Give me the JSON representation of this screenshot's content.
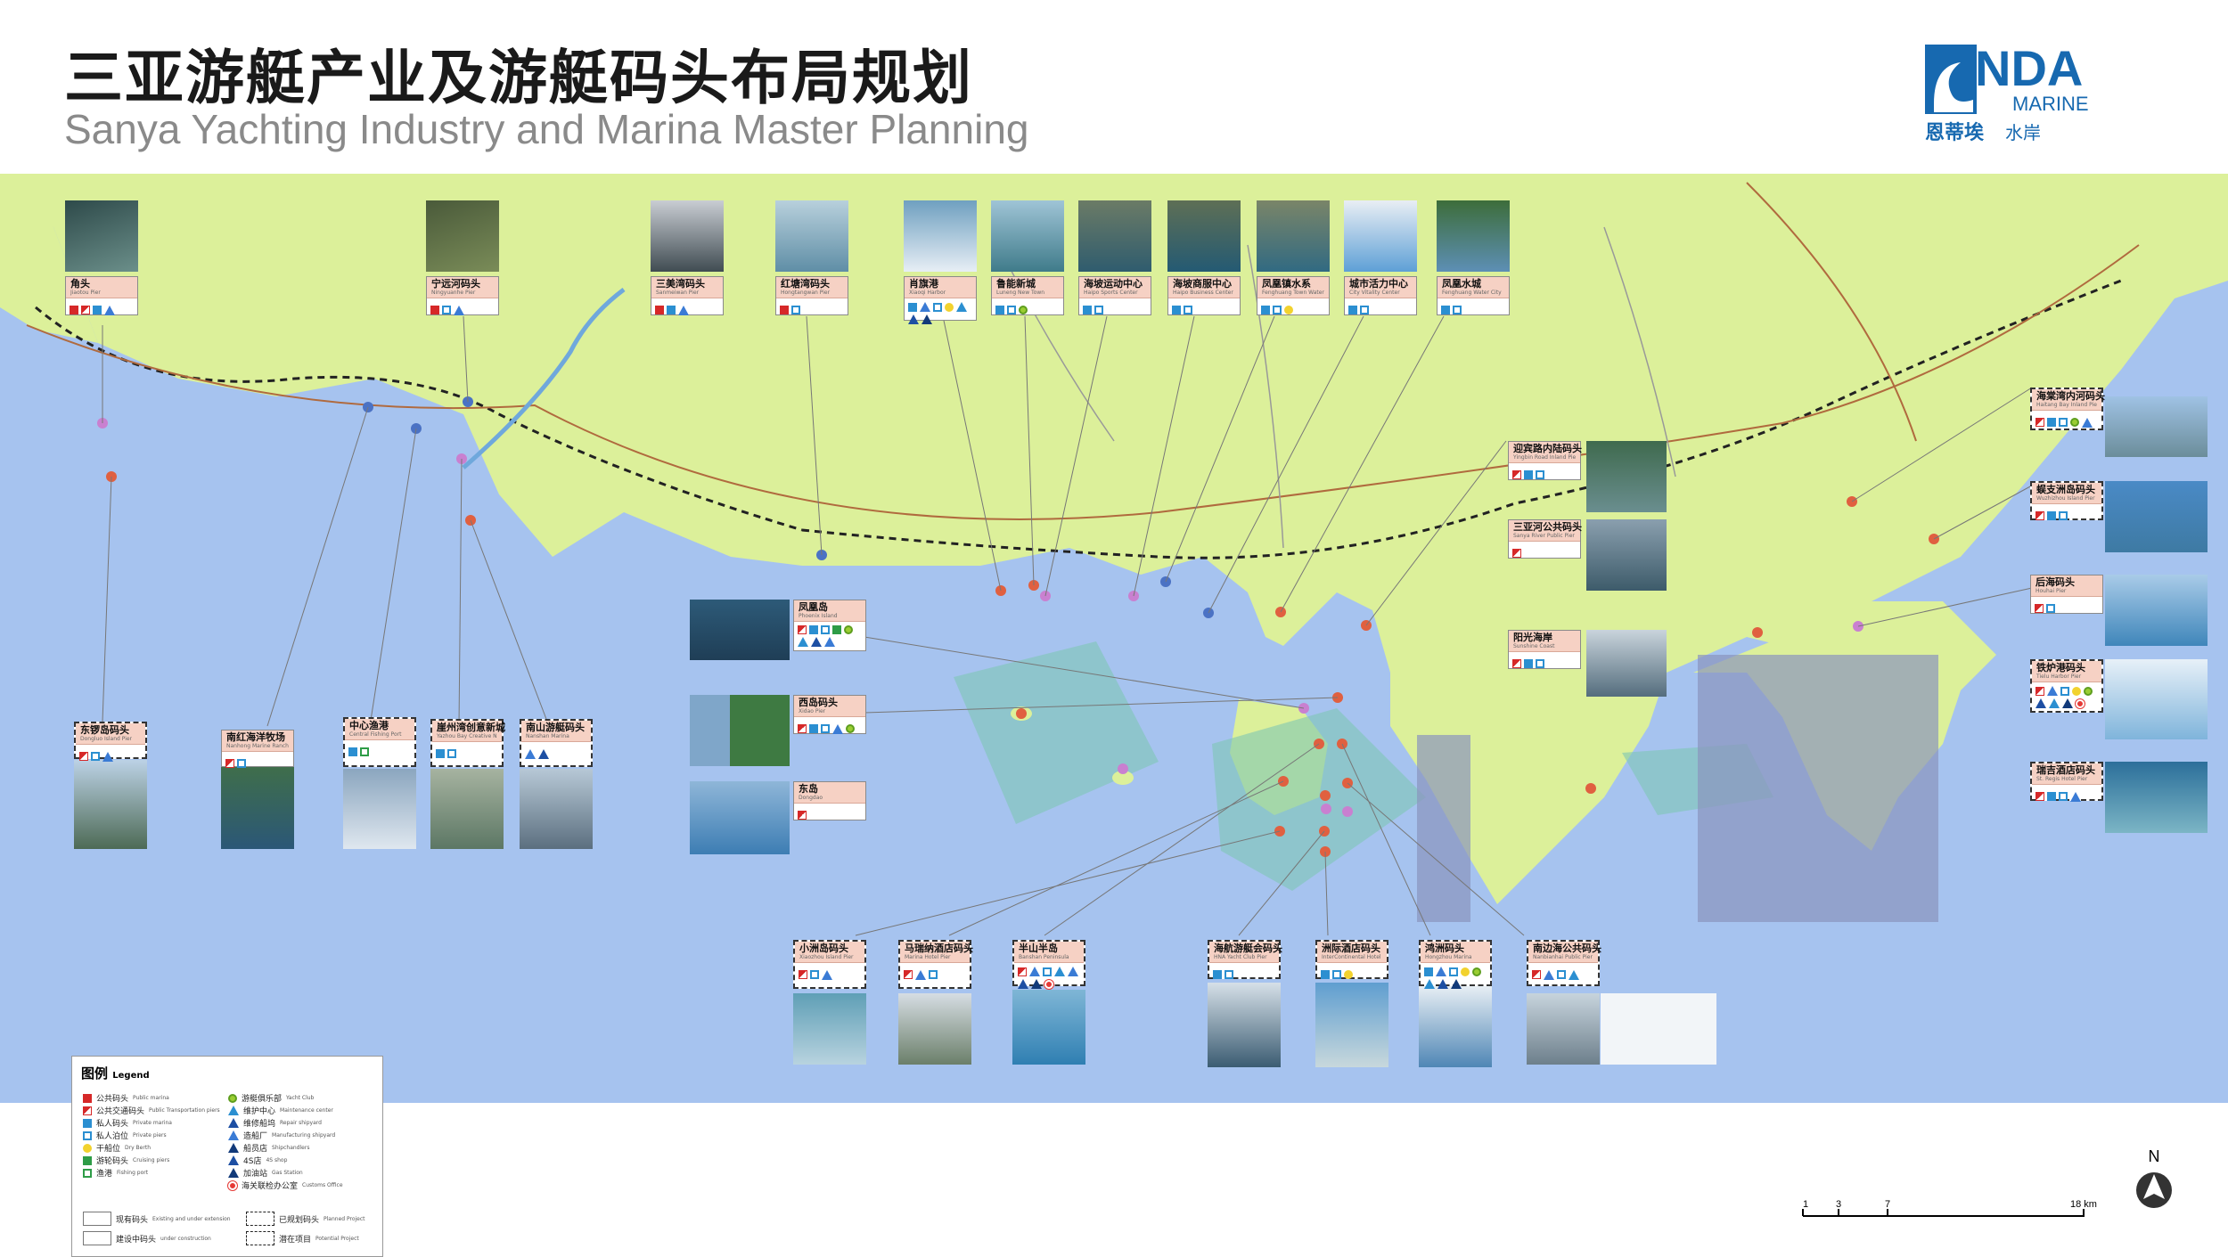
{
  "title_cn": "三亚游艇产业及游艇码头布局规划",
  "title_en": "Sanya Yachting Industry and Marina Master Planning",
  "logo": {
    "letters": "NDA",
    "line2": "MARINE",
    "cn": "恩蒂埃",
    "cn2": "水岸"
  },
  "colors": {
    "sea": "#a6c3ef",
    "land": "#dcf09a",
    "public": "#d62828",
    "private": "#2b8fd1",
    "header_pink": "#f6d1c4"
  },
  "callouts": [
    {
      "id": "jiaotou",
      "cn": "角头",
      "en": "Jiaotou Pier",
      "icons": [
        "pub",
        "pt",
        "pm",
        "ms"
      ]
    },
    {
      "id": "ningyuanhe",
      "cn": "宁远河码头",
      "en": "Ningyuanhe Pier",
      "icons": [
        "pub",
        "pb",
        "ms"
      ]
    },
    {
      "id": "sanmeiwan",
      "cn": "三美湾码头",
      "en": "Sanmeiwan Pier",
      "icons": [
        "pub",
        "pm",
        "ms"
      ]
    },
    {
      "id": "hongtangwan",
      "cn": "红塘湾码头",
      "en": "Hongtangwan Pier",
      "icons": [
        "pub",
        "pb"
      ]
    },
    {
      "id": "xiaogang",
      "cn": "肖旗港",
      "en": "Xiaoqi Harbor",
      "icons": [
        "pm",
        "ms",
        "pb",
        "db",
        "mc",
        "rs",
        "sc"
      ]
    },
    {
      "id": "luneng",
      "cn": "鲁能新城",
      "en": "Luneng New Town",
      "icons": [
        "pm",
        "pb",
        "yc"
      ]
    },
    {
      "id": "haipo",
      "cn": "海坡运动中心",
      "en": "Haipo Sports Center",
      "icons": [
        "pm",
        "pb"
      ]
    },
    {
      "id": "haipodp",
      "cn": "海坡商服中心",
      "en": "Haipo Business Center",
      "icons": [
        "pm",
        "pb"
      ]
    },
    {
      "id": "fenghuangzhen",
      "cn": "凤凰镇水系",
      "en": "Fenghuang Town Water System",
      "icons": [
        "pm",
        "pb",
        "db"
      ]
    },
    {
      "id": "chengshi",
      "cn": "城市活力中心",
      "en": "City Vitality Center",
      "icons": [
        "pm",
        "pb"
      ]
    },
    {
      "id": "fenghuangshui",
      "cn": "凤凰水城",
      "en": "Fenghuang Water City",
      "icons": [
        "pm",
        "pb"
      ]
    },
    {
      "id": "yingbin",
      "cn": "迎宾路内陆码头",
      "en": "Yingbin Road Inland Pier",
      "icons": [
        "pt",
        "pm",
        "pb"
      ]
    },
    {
      "id": "sanyahe",
      "cn": "三亚河公共码头",
      "en": "Sanya River Public Pier",
      "icons": [
        "pt"
      ]
    },
    {
      "id": "yangguang",
      "cn": "阳光海岸",
      "en": "Sunshine Coast",
      "icons": [
        "pt",
        "pm",
        "pb"
      ]
    },
    {
      "id": "haitang",
      "cn": "海棠湾内河码头",
      "en": "Haitang Bay Inland Pier",
      "icons": [
        "pt",
        "pm",
        "pb",
        "yc",
        "ms"
      ]
    },
    {
      "id": "wuzhizhou",
      "cn": "蜈支洲岛码头",
      "en": "Wuzhizhou Island Pier",
      "icons": [
        "pt",
        "pm",
        "pb"
      ]
    },
    {
      "id": "houhai",
      "cn": "后海码头",
      "en": "Houhai Pier",
      "icons": [
        "pt",
        "pb"
      ]
    },
    {
      "id": "tielu",
      "cn": "铁炉港码头",
      "en": "Tielu Harbor Pier",
      "icons": [
        "pt",
        "ms",
        "pb",
        "db",
        "yc",
        "rs",
        "mc",
        "sc",
        "co"
      ]
    },
    {
      "id": "rizhao",
      "cn": "瑞吉酒店码头",
      "en": "St. Regis Hotel Pier",
      "icons": [
        "pt",
        "pm",
        "pb",
        "ms"
      ]
    },
    {
      "id": "dongmao",
      "cn": "东锣岛码头",
      "en": "Dongluo Island Pier",
      "icons": [
        "pt",
        "pb",
        "ms"
      ]
    },
    {
      "id": "nanhong",
      "cn": "南红海洋牧场",
      "en": "Nanhong Marine Ranch",
      "icons": [
        "pt",
        "pb"
      ]
    },
    {
      "id": "zhongxin",
      "cn": "中心渔港",
      "en": "Central Fishing Port",
      "icons": [
        "pm",
        "fp"
      ]
    },
    {
      "id": "yazhouwan",
      "cn": "崖州湾创意新城",
      "en": "Yazhou Bay Creative New Town",
      "icons": [
        "pm",
        "pb"
      ]
    },
    {
      "id": "nanshan",
      "cn": "南山游艇码头",
      "en": "Nanshan Marina",
      "icons": [
        "ms",
        "rs"
      ]
    },
    {
      "id": "fenghuangdao",
      "cn": "凤凰岛",
      "en": "Phoenix Island",
      "icons": [
        "pt",
        "pm",
        "pb",
        "cp",
        "yc",
        "mc",
        "rs",
        "ms"
      ]
    },
    {
      "id": "xidao",
      "cn": "西岛码头",
      "en": "Xidao Pier",
      "icons": [
        "pt",
        "pm",
        "pb",
        "ms",
        "yc"
      ]
    },
    {
      "id": "dongdao",
      "cn": "东岛",
      "en": "Dongdao",
      "icons": [
        "pt"
      ]
    },
    {
      "id": "xiaozhou",
      "cn": "小洲岛码头",
      "en": "Xiaozhou Island Pier",
      "icons": [
        "pt",
        "pb",
        "ms"
      ]
    },
    {
      "id": "malin",
      "cn": "马瑞纳酒店码头",
      "en": "Marina Hotel Pier",
      "icons": [
        "pt",
        "ms",
        "pb"
      ]
    },
    {
      "id": "banshan",
      "cn": "半山半岛",
      "en": "Banshan Peninsula",
      "icons": [
        "pt",
        "ms",
        "pb",
        "mc",
        "ms",
        "rs",
        "sc",
        "co"
      ]
    },
    {
      "id": "haihang",
      "cn": "海航游艇会码头",
      "en": "HNA Yacht Club Pier",
      "icons": [
        "pm",
        "pb"
      ]
    },
    {
      "id": "zhouji",
      "cn": "洲际酒店码头",
      "en": "InterContinental Hotel Pier",
      "icons": [
        "pm",
        "pb",
        "db"
      ]
    },
    {
      "id": "hongzhou",
      "cn": "鸿洲码头",
      "en": "Hongzhou Marina",
      "icons": [
        "pm",
        "ms",
        "pb",
        "db",
        "yc",
        "mc",
        "rs",
        "sc"
      ]
    },
    {
      "id": "nanbianhai",
      "cn": "南边海公共码头",
      "en": "Nanbianhai Public Pier",
      "icons": [
        "pt",
        "ms",
        "pb",
        "mc"
      ]
    }
  ],
  "legend": {
    "title_cn": "图例",
    "title_en": "Legend",
    "items": [
      {
        "icon": "pub",
        "cn": "公共码头",
        "en": "Public marina"
      },
      {
        "icon": "pt",
        "cn": "公共交通码头",
        "en": "Public Transportation piers"
      },
      {
        "icon": "pm",
        "cn": "私人码头",
        "en": "Private marina"
      },
      {
        "icon": "pb",
        "cn": "私人泊位",
        "en": "Private piers"
      },
      {
        "icon": "db",
        "cn": "干船位",
        "en": "Dry Berth"
      },
      {
        "icon": "cp",
        "cn": "游轮码头",
        "en": "Cruising piers"
      },
      {
        "icon": "fp",
        "cn": "渔港",
        "en": "Fishing port"
      },
      {
        "icon": "yc",
        "cn": "游艇俱乐部",
        "en": "Yacht Club"
      },
      {
        "icon": "mc",
        "cn": "维护中心",
        "en": "Maintenance center"
      },
      {
        "icon": "rs",
        "cn": "维修船坞",
        "en": "Repair shipyard"
      },
      {
        "icon": "ms",
        "cn": "造船厂",
        "en": "Manufacturing shipyard"
      },
      {
        "icon": "sc",
        "cn": "船员店",
        "en": "Shipchandlers"
      },
      {
        "icon": "rs",
        "cn": "4S店",
        "en": "4S shop"
      },
      {
        "icon": "sc",
        "cn": "加油站",
        "en": "Gas Station"
      },
      {
        "icon": "co",
        "cn": "海关联检办公室",
        "en": "Customs Office"
      }
    ],
    "status": [
      {
        "cn": "现有码头",
        "en": "Existing and under extension"
      },
      {
        "cn": "建设中码头",
        "en": "under construction"
      },
      {
        "cn": "已规划码头",
        "en": "Planned Project"
      },
      {
        "cn": "潜在项目",
        "en": "Potential Project"
      }
    ]
  },
  "scale": {
    "ticks": [
      "1",
      "3",
      "7",
      "18 km"
    ]
  },
  "north": "N"
}
